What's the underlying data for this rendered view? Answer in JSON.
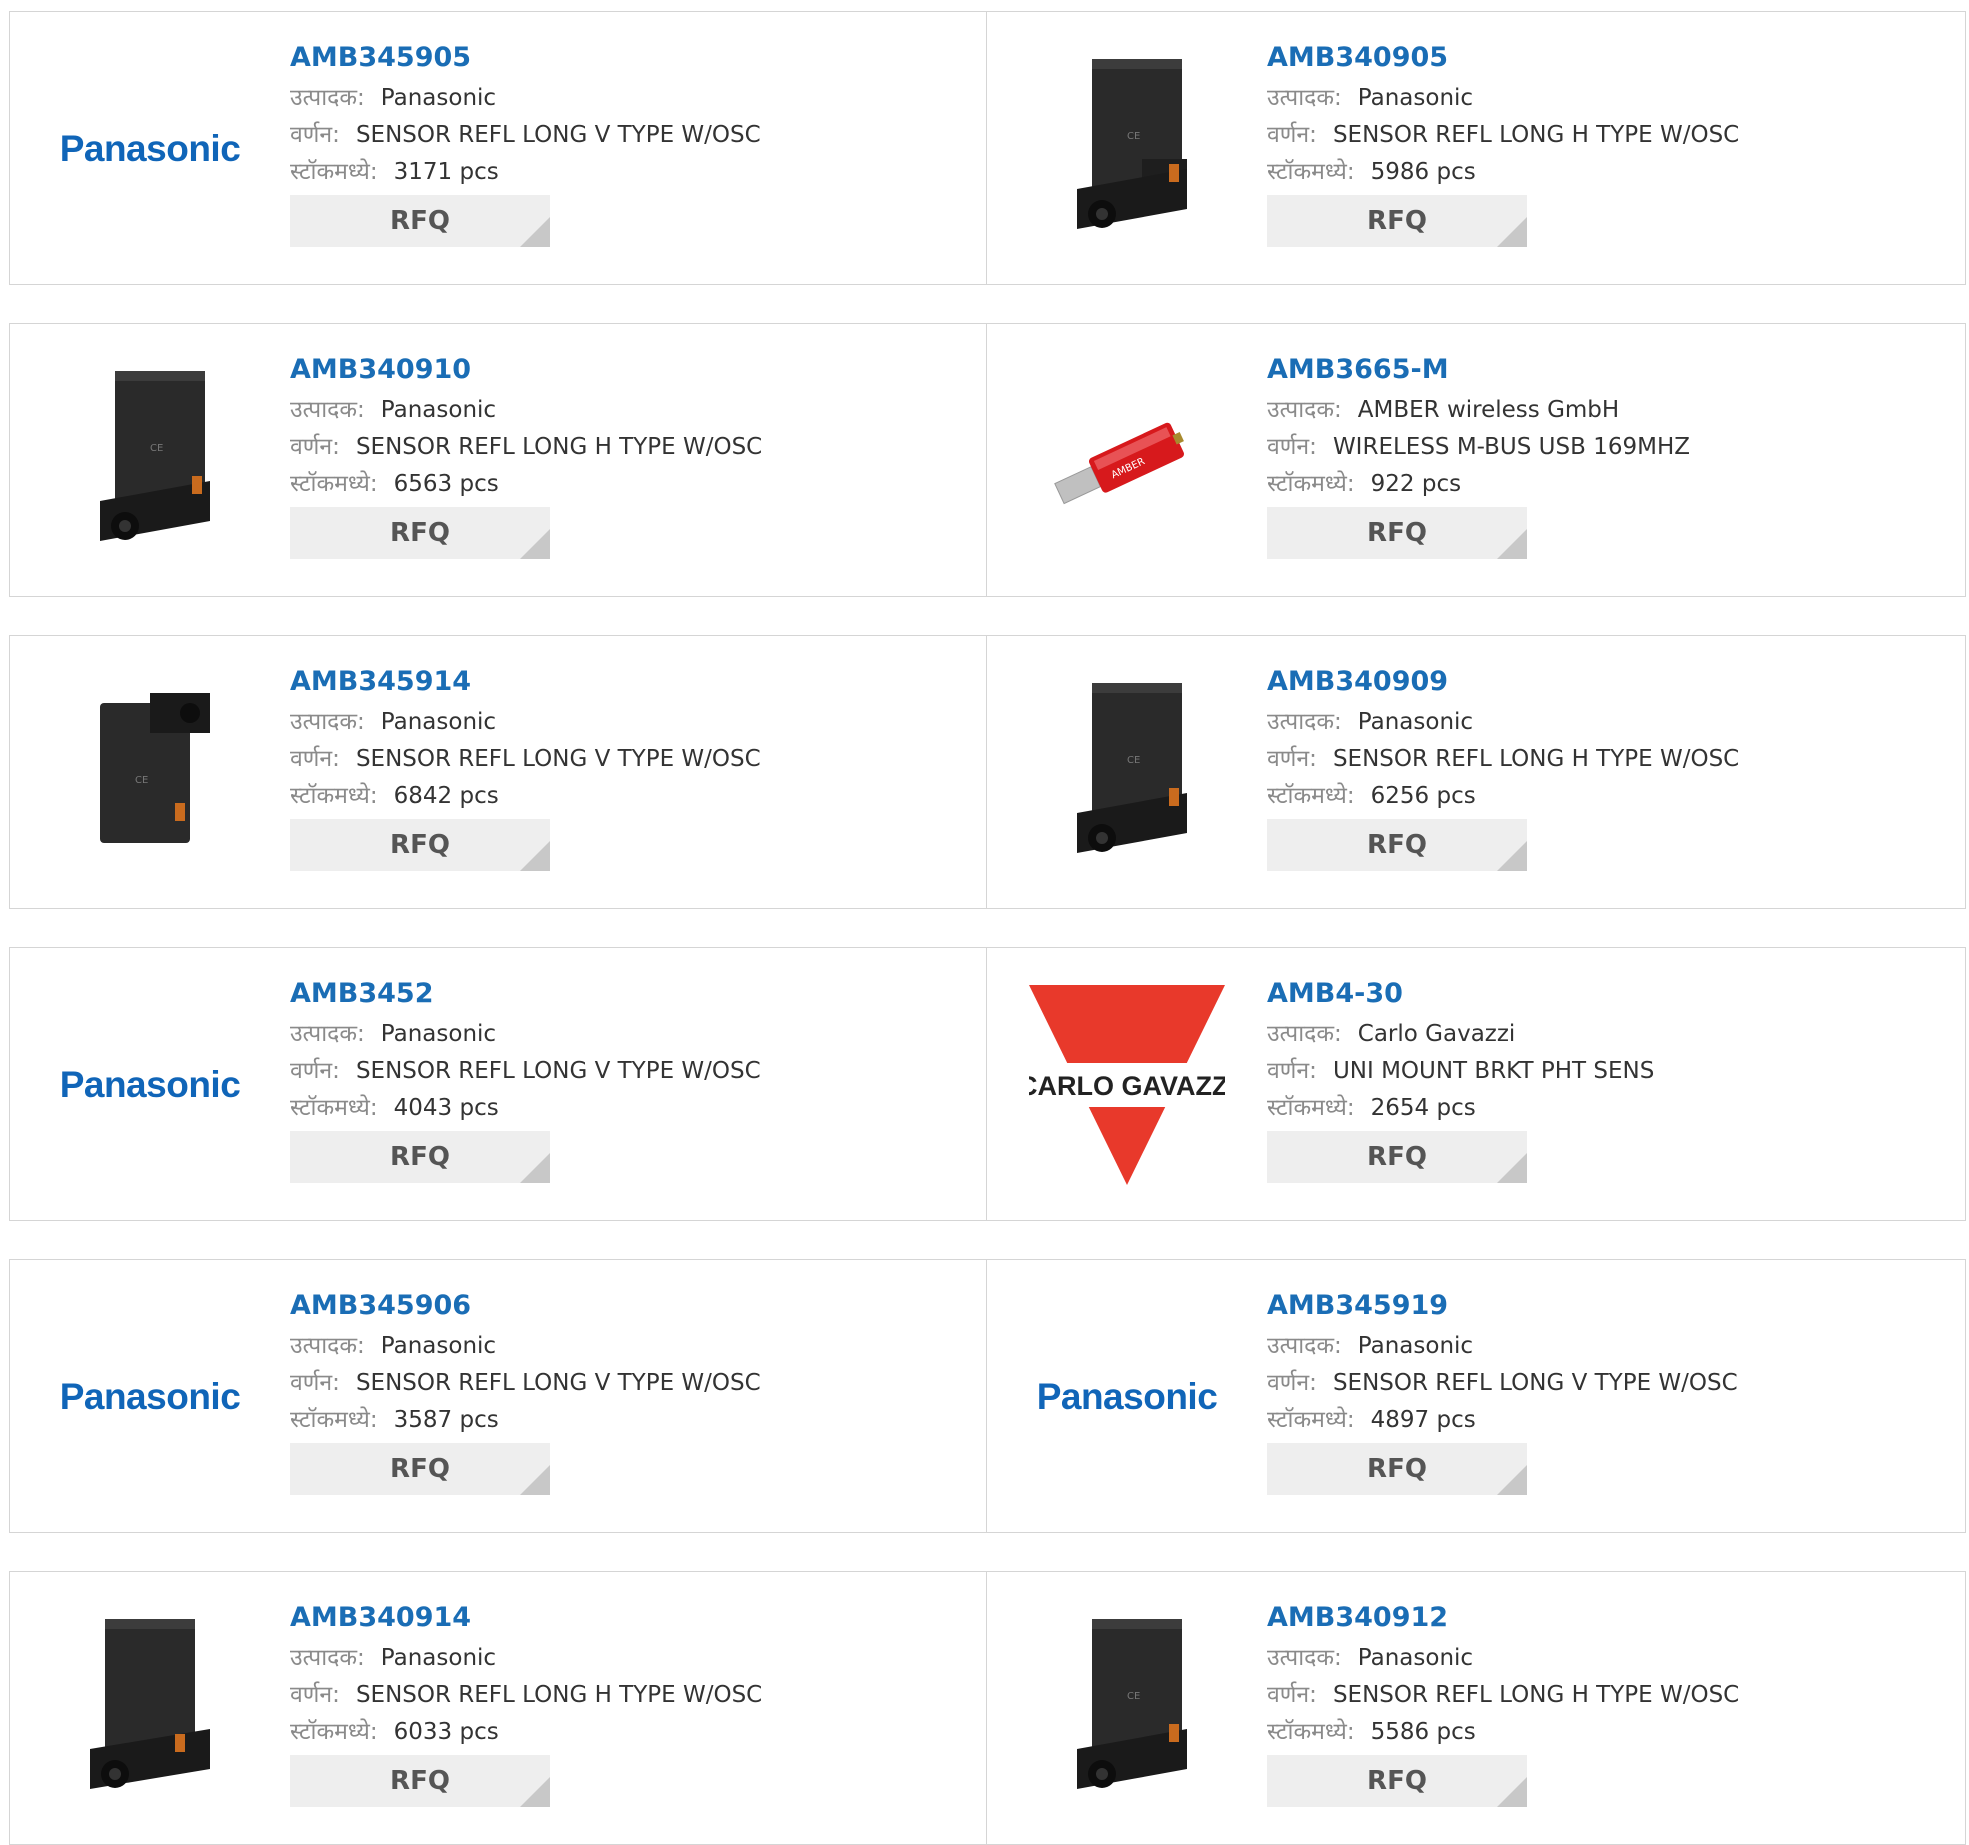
{
  "labels": {
    "manufacturer": "उत्पादक:",
    "description": "वर्णन:",
    "in_stock": "स्टॉकमध्ये:",
    "rfq": "RFQ"
  },
  "colors": {
    "part_link": "#1a6db5",
    "panasonic_blue": "#1065b8",
    "gavazzi_red": "#e8392b",
    "rfq_bg": "#eeeeee"
  },
  "products": [
    {
      "part": "AMB345905",
      "manufacturer": "Panasonic",
      "description": "SENSOR REFL LONG V TYPE W/OSC",
      "stock": "3171 pcs",
      "image": "panasonic-logo",
      "brand_text": "Panasonic"
    },
    {
      "part": "AMB340905",
      "manufacturer": "Panasonic",
      "description": "SENSOR REFL LONG H TYPE W/OSC",
      "stock": "5986 pcs",
      "image": "sensor-photo"
    },
    {
      "part": "AMB340910",
      "manufacturer": "Panasonic",
      "description": "SENSOR REFL LONG H TYPE W/OSC",
      "stock": "6563 pcs",
      "image": "sensor-photo"
    },
    {
      "part": "AMB3665-M",
      "manufacturer": "AMBER wireless GmbH",
      "description": "WIRELESS M-BUS USB 169MHZ",
      "stock": "922 pcs",
      "image": "usb-stick-photo"
    },
    {
      "part": "AMB345914",
      "manufacturer": "Panasonic",
      "description": "SENSOR REFL LONG V TYPE W/OSC",
      "stock": "6842 pcs",
      "image": "sensor-photo"
    },
    {
      "part": "AMB340909",
      "manufacturer": "Panasonic",
      "description": "SENSOR REFL LONG H TYPE W/OSC",
      "stock": "6256 pcs",
      "image": "sensor-photo"
    },
    {
      "part": "AMB3452",
      "manufacturer": "Panasonic",
      "description": "SENSOR REFL LONG V TYPE W/OSC",
      "stock": "4043 pcs",
      "image": "panasonic-logo",
      "brand_text": "Panasonic"
    },
    {
      "part": "AMB4-30",
      "manufacturer": "Carlo Gavazzi",
      "description": "UNI MOUNT BRKT PHT SENS",
      "stock": "2654 pcs",
      "image": "carlo-gavazzi-logo",
      "brand_text": "CARLO GAVAZZI"
    },
    {
      "part": "AMB345906",
      "manufacturer": "Panasonic",
      "description": "SENSOR REFL LONG V TYPE W/OSC",
      "stock": "3587 pcs",
      "image": "panasonic-logo",
      "brand_text": "Panasonic"
    },
    {
      "part": "AMB345919",
      "manufacturer": "Panasonic",
      "description": "SENSOR REFL LONG V TYPE W/OSC",
      "stock": "4897 pcs",
      "image": "panasonic-logo",
      "brand_text": "Panasonic"
    },
    {
      "part": "AMB340914",
      "manufacturer": "Panasonic",
      "description": "SENSOR REFL LONG H TYPE W/OSC",
      "stock": "6033 pcs",
      "image": "sensor-photo"
    },
    {
      "part": "AMB340912",
      "manufacturer": "Panasonic",
      "description": "SENSOR REFL LONG H TYPE W/OSC",
      "stock": "5586 pcs",
      "image": "sensor-photo"
    }
  ]
}
